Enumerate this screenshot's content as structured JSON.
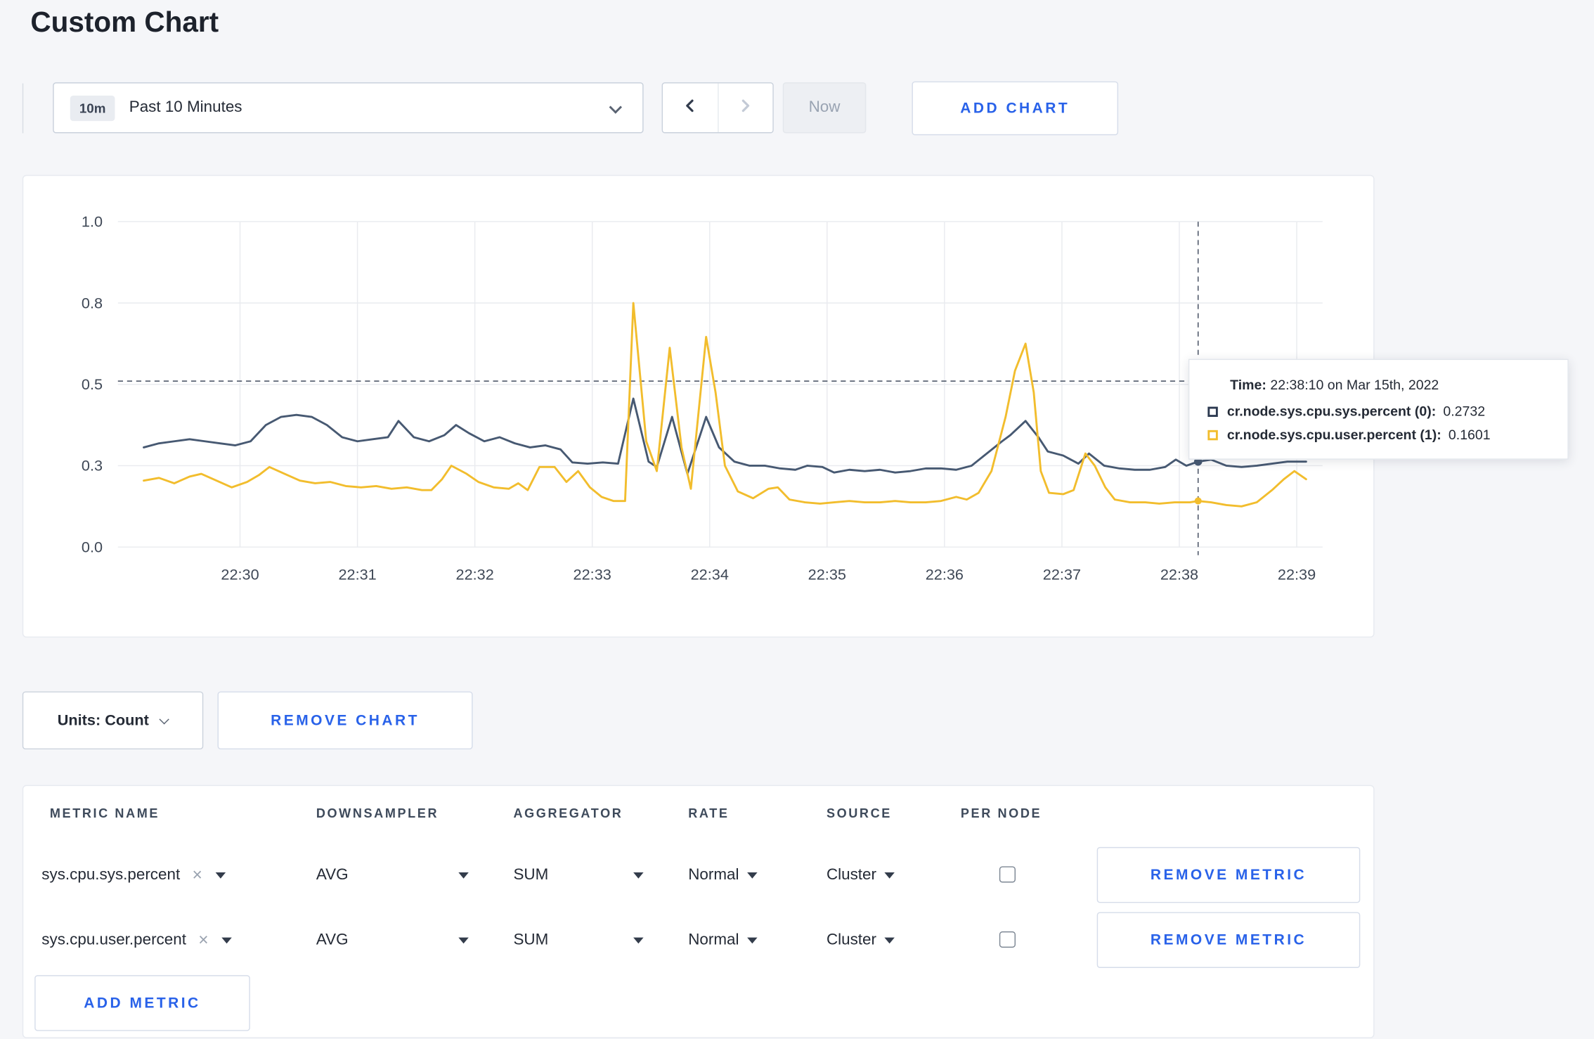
{
  "page": {
    "title": "Custom Chart",
    "background": "#f5f6f9"
  },
  "toolbar": {
    "time_window_badge": "10m",
    "time_window_label": "Past 10 Minutes",
    "now_label": "Now",
    "add_chart_label": "ADD CHART"
  },
  "chart_data": {
    "type": "line",
    "title": "",
    "xlabel": "",
    "ylabel": "",
    "ylim": [
      0,
      1
    ],
    "grid": true,
    "legend": "none",
    "x_domain": [
      -1.04,
      9.22
    ],
    "y_ticks": [
      {
        "value": 0,
        "label": "0.0"
      },
      {
        "value": 0.3,
        "label": "0.3"
      },
      {
        "value": 0.5,
        "label": "0.5"
      },
      {
        "value": 0.8,
        "label": "0.8"
      },
      {
        "value": 1,
        "label": "1.0"
      }
    ],
    "x_ticks": [
      {
        "m": 0,
        "label": "22:30"
      },
      {
        "m": 1,
        "label": "22:31"
      },
      {
        "m": 2,
        "label": "22:32"
      },
      {
        "m": 3,
        "label": "22:33"
      },
      {
        "m": 4,
        "label": "22:34"
      },
      {
        "m": 5,
        "label": "22:35"
      },
      {
        "m": 6,
        "label": "22:36"
      },
      {
        "m": 7,
        "label": "22:37"
      },
      {
        "m": 8,
        "label": "22:38"
      },
      {
        "m": 9,
        "label": "22:39"
      }
    ],
    "crosshair": {
      "x_m": 8.16,
      "y_value": 0.512,
      "color": "#414b5e"
    },
    "markers": [
      {
        "series": 0,
        "m": 8.16,
        "v": 0.31
      },
      {
        "series": 1,
        "m": 8.16,
        "v": 0.17
      }
    ],
    "series": [
      {
        "name": "cr.node.sys.cpu.sys.percent",
        "color": "#475972",
        "points": [
          [
            -0.82,
            0.345
          ],
          [
            -0.69,
            0.355
          ],
          [
            -0.56,
            0.36
          ],
          [
            -0.43,
            0.365
          ],
          [
            -0.3,
            0.36
          ],
          [
            -0.17,
            0.355
          ],
          [
            -0.04,
            0.35
          ],
          [
            0.09,
            0.36
          ],
          [
            0.22,
            0.4
          ],
          [
            0.35,
            0.42
          ],
          [
            0.48,
            0.425
          ],
          [
            0.61,
            0.42
          ],
          [
            0.74,
            0.4
          ],
          [
            0.87,
            0.37
          ],
          [
            1.0,
            0.36
          ],
          [
            1.13,
            0.365
          ],
          [
            1.26,
            0.37
          ],
          [
            1.35,
            0.41
          ],
          [
            1.48,
            0.37
          ],
          [
            1.61,
            0.36
          ],
          [
            1.74,
            0.375
          ],
          [
            1.84,
            0.4
          ],
          [
            1.95,
            0.38
          ],
          [
            2.08,
            0.36
          ],
          [
            2.21,
            0.37
          ],
          [
            2.34,
            0.355
          ],
          [
            2.47,
            0.345
          ],
          [
            2.6,
            0.35
          ],
          [
            2.73,
            0.34
          ],
          [
            2.83,
            0.308
          ],
          [
            2.96,
            0.305
          ],
          [
            3.09,
            0.308
          ],
          [
            3.22,
            0.305
          ],
          [
            3.35,
            0.465
          ],
          [
            3.48,
            0.31
          ],
          [
            3.55,
            0.295
          ],
          [
            3.68,
            0.42
          ],
          [
            3.81,
            0.27
          ],
          [
            3.97,
            0.42
          ],
          [
            4.08,
            0.345
          ],
          [
            4.21,
            0.31
          ],
          [
            4.34,
            0.3
          ],
          [
            4.47,
            0.3
          ],
          [
            4.6,
            0.29
          ],
          [
            4.73,
            0.285
          ],
          [
            4.83,
            0.3
          ],
          [
            4.96,
            0.295
          ],
          [
            5.06,
            0.275
          ],
          [
            5.19,
            0.285
          ],
          [
            5.32,
            0.28
          ],
          [
            5.45,
            0.285
          ],
          [
            5.58,
            0.275
          ],
          [
            5.71,
            0.28
          ],
          [
            5.84,
            0.29
          ],
          [
            5.97,
            0.29
          ],
          [
            6.1,
            0.285
          ],
          [
            6.23,
            0.3
          ],
          [
            6.36,
            0.33
          ],
          [
            6.49,
            0.36
          ],
          [
            6.56,
            0.375
          ],
          [
            6.69,
            0.41
          ],
          [
            6.8,
            0.37
          ],
          [
            6.88,
            0.335
          ],
          [
            7.01,
            0.325
          ],
          [
            7.14,
            0.305
          ],
          [
            7.23,
            0.33
          ],
          [
            7.36,
            0.3
          ],
          [
            7.49,
            0.29
          ],
          [
            7.62,
            0.285
          ],
          [
            7.75,
            0.285
          ],
          [
            7.88,
            0.295
          ],
          [
            7.97,
            0.315
          ],
          [
            8.06,
            0.3
          ],
          [
            8.16,
            0.31
          ],
          [
            8.27,
            0.315
          ],
          [
            8.4,
            0.3
          ],
          [
            8.53,
            0.295
          ],
          [
            8.66,
            0.3
          ],
          [
            8.79,
            0.305
          ],
          [
            8.92,
            0.31
          ],
          [
            9.08,
            0.31
          ]
        ]
      },
      {
        "name": "cr.node.sys.cpu.user.percent",
        "color": "#f2bd2d",
        "points": [
          [
            -0.82,
            0.245
          ],
          [
            -0.69,
            0.255
          ],
          [
            -0.56,
            0.235
          ],
          [
            -0.43,
            0.26
          ],
          [
            -0.33,
            0.27
          ],
          [
            -0.2,
            0.245
          ],
          [
            -0.07,
            0.22
          ],
          [
            0.06,
            0.24
          ],
          [
            0.16,
            0.265
          ],
          [
            0.25,
            0.295
          ],
          [
            0.38,
            0.27
          ],
          [
            0.51,
            0.245
          ],
          [
            0.64,
            0.235
          ],
          [
            0.77,
            0.24
          ],
          [
            0.9,
            0.225
          ],
          [
            1.03,
            0.22
          ],
          [
            1.16,
            0.225
          ],
          [
            1.29,
            0.215
          ],
          [
            1.42,
            0.22
          ],
          [
            1.55,
            0.21
          ],
          [
            1.63,
            0.21
          ],
          [
            1.72,
            0.25
          ],
          [
            1.8,
            0.3
          ],
          [
            1.93,
            0.27
          ],
          [
            2.03,
            0.24
          ],
          [
            2.16,
            0.22
          ],
          [
            2.29,
            0.215
          ],
          [
            2.37,
            0.235
          ],
          [
            2.45,
            0.21
          ],
          [
            2.55,
            0.295
          ],
          [
            2.68,
            0.295
          ],
          [
            2.78,
            0.24
          ],
          [
            2.88,
            0.28
          ],
          [
            2.98,
            0.22
          ],
          [
            3.08,
            0.185
          ],
          [
            3.18,
            0.17
          ],
          [
            3.28,
            0.17
          ],
          [
            3.35,
            0.8
          ],
          [
            3.46,
            0.36
          ],
          [
            3.55,
            0.28
          ],
          [
            3.66,
            0.635
          ],
          [
            3.76,
            0.345
          ],
          [
            3.84,
            0.215
          ],
          [
            3.97,
            0.675
          ],
          [
            4.05,
            0.48
          ],
          [
            4.13,
            0.3
          ],
          [
            4.24,
            0.205
          ],
          [
            4.37,
            0.18
          ],
          [
            4.5,
            0.215
          ],
          [
            4.58,
            0.22
          ],
          [
            4.68,
            0.175
          ],
          [
            4.81,
            0.165
          ],
          [
            4.94,
            0.16
          ],
          [
            5.06,
            0.165
          ],
          [
            5.19,
            0.17
          ],
          [
            5.32,
            0.165
          ],
          [
            5.45,
            0.165
          ],
          [
            5.58,
            0.17
          ],
          [
            5.71,
            0.165
          ],
          [
            5.84,
            0.165
          ],
          [
            5.97,
            0.17
          ],
          [
            6.1,
            0.185
          ],
          [
            6.19,
            0.175
          ],
          [
            6.29,
            0.2
          ],
          [
            6.4,
            0.28
          ],
          [
            6.52,
            0.42
          ],
          [
            6.6,
            0.55
          ],
          [
            6.69,
            0.65
          ],
          [
            6.76,
            0.48
          ],
          [
            6.82,
            0.28
          ],
          [
            6.89,
            0.2
          ],
          [
            7.01,
            0.195
          ],
          [
            7.1,
            0.21
          ],
          [
            7.2,
            0.33
          ],
          [
            7.28,
            0.3
          ],
          [
            7.37,
            0.22
          ],
          [
            7.45,
            0.175
          ],
          [
            7.58,
            0.165
          ],
          [
            7.71,
            0.165
          ],
          [
            7.83,
            0.16
          ],
          [
            7.96,
            0.165
          ],
          [
            8.09,
            0.165
          ],
          [
            8.16,
            0.17
          ],
          [
            8.27,
            0.165
          ],
          [
            8.4,
            0.155
          ],
          [
            8.53,
            0.15
          ],
          [
            8.66,
            0.165
          ],
          [
            8.79,
            0.21
          ],
          [
            8.89,
            0.25
          ],
          [
            8.98,
            0.28
          ],
          [
            9.08,
            0.25
          ]
        ]
      }
    ]
  },
  "tooltip": {
    "time_label": "Time:",
    "time_value": "22:38:10 on Mar 15th, 2022",
    "rows": [
      {
        "label": "cr.node.sys.cpu.sys.percent (0):",
        "value": "0.2732",
        "color": "#2c3950"
      },
      {
        "label": "cr.node.sys.cpu.user.percent (1):",
        "value": "0.1601",
        "color": "#f2bd2d"
      }
    ]
  },
  "chart_controls": {
    "units_label": "Units: Count",
    "remove_chart_label": "REMOVE CHART"
  },
  "metrics_table": {
    "headers": [
      "METRIC NAME",
      "DOWNSAMPLER",
      "AGGREGATOR",
      "RATE",
      "SOURCE",
      "PER NODE"
    ],
    "clear_glyph": "×",
    "rows": [
      {
        "metric": "sys.cpu.sys.percent",
        "downsampler": "AVG",
        "aggregator": "SUM",
        "rate": "Normal",
        "source": "Cluster",
        "per_node": false,
        "remove_label": "REMOVE METRIC"
      },
      {
        "metric": "sys.cpu.user.percent",
        "downsampler": "AVG",
        "aggregator": "SUM",
        "rate": "Normal",
        "source": "Cluster",
        "per_node": false,
        "remove_label": "REMOVE METRIC"
      }
    ],
    "add_metric_label": "ADD METRIC"
  }
}
